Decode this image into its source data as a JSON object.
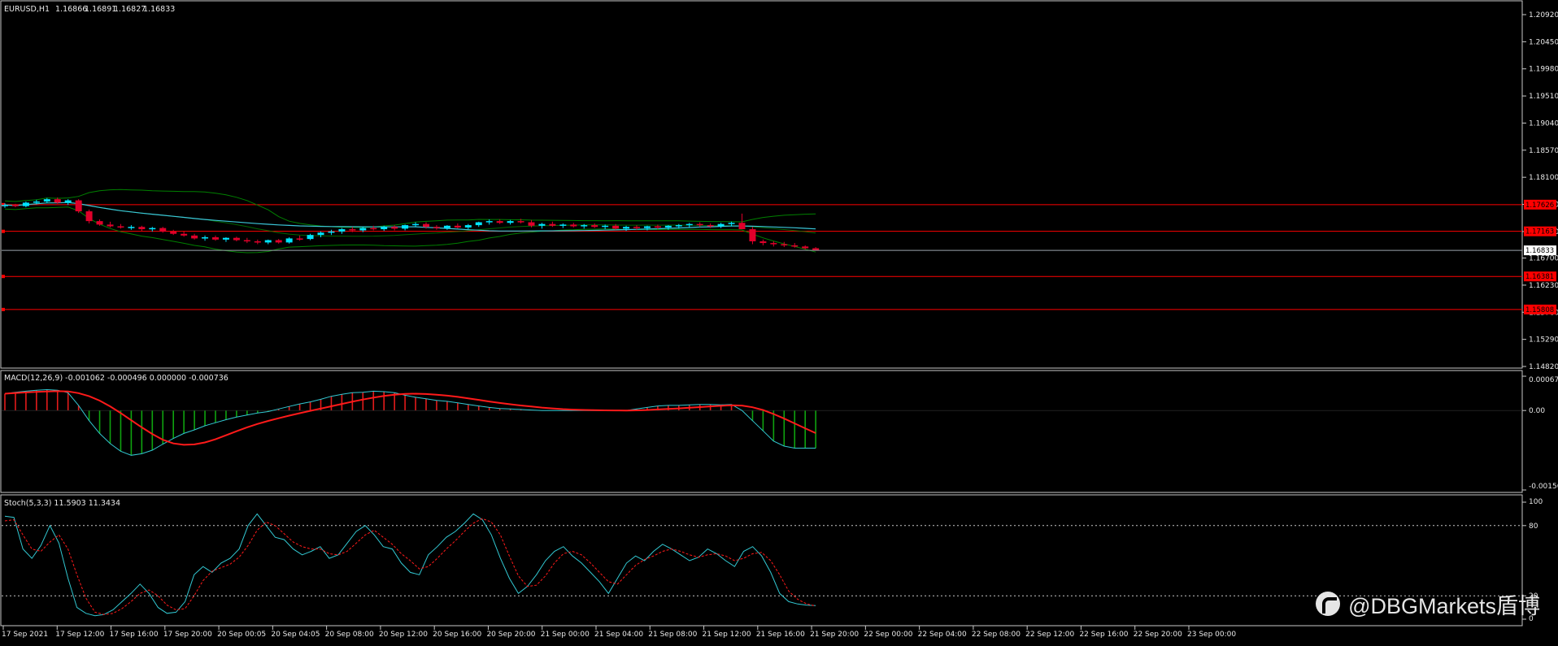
{
  "price_header": {
    "symbol": "EURUSD,H1",
    "open": "1.16866",
    "high": "1.16891",
    "low": "1.16827",
    "close": "1.16833"
  },
  "price_axis": {
    "ticks": [
      "1.20920",
      "1.20450",
      "1.19980",
      "1.19510",
      "1.19040",
      "1.18570",
      "1.18100",
      "1.17630",
      "1.17160",
      "1.16700",
      "1.16230",
      "1.15760",
      "1.15290",
      "1.14820"
    ],
    "current_price_label": "1.16833",
    "hline_labels": [
      "1.17626",
      "1.17163",
      "1.16381",
      "1.15808"
    ]
  },
  "macd": {
    "header": "MACD(12,26,9) -0.001062 -0.000496 0.000000 -0.000736",
    "ticks": [
      "0.000674",
      "0.00",
      "-0.001562"
    ]
  },
  "stoch": {
    "header": "Stoch(5,3,3) 11.5903 11.3434",
    "ticks": [
      "100",
      "80",
      "20",
      "0"
    ]
  },
  "time_axis": {
    "labels": [
      "17 Sep 2021",
      "17 Sep 12:00",
      "17 Sep 16:00",
      "17 Sep 20:00",
      "20 Sep 00:05",
      "20 Sep 04:05",
      "20 Sep 08:00",
      "20 Sep 12:00",
      "20 Sep 16:00",
      "20 Sep 20:00",
      "21 Sep 00:00",
      "21 Sep 04:00",
      "21 Sep 08:00",
      "21 Sep 12:00",
      "21 Sep 16:00",
      "21 Sep 20:00",
      "22 Sep 00:00",
      "22 Sep 04:00",
      "22 Sep 08:00",
      "22 Sep 12:00",
      "22 Sep 16:00",
      "22 Sep 20:00",
      "23 Sep 00:00"
    ]
  },
  "watermark": {
    "text": "@DBGMarkets盾博"
  },
  "colors": {
    "background": "#000000",
    "bull_candle": "#00e5ff",
    "bear_candle": "#e0002a",
    "hline": "#ff0000",
    "bollinger": "#008000",
    "moving_average": "#3bc6d8",
    "macd_main": "#32c8d2",
    "macd_signal": "#ff1a1a",
    "stoch_main": "#32c8d2",
    "stoch_signal": "#ff1a1a"
  },
  "chart_data": [
    {
      "type": "candlestick",
      "title": "EURUSD,H1",
      "ylim": [
        1.1482,
        1.2092
      ],
      "horizontal_levels": [
        1.17626,
        1.17163,
        1.16381,
        1.15808
      ],
      "current_price": 1.16833,
      "bar_count": 91,
      "candles": [
        [
          1.176,
          1.1765,
          1.1757,
          1.1762
        ],
        [
          1.1762,
          1.1764,
          1.1758,
          1.176
        ],
        [
          1.176,
          1.1768,
          1.1758,
          1.1766
        ],
        [
          1.1766,
          1.1771,
          1.1763,
          1.1768
        ],
        [
          1.1768,
          1.1774,
          1.1765,
          1.1772
        ],
        [
          1.1772,
          1.1775,
          1.1764,
          1.1766
        ],
        [
          1.1766,
          1.1772,
          1.1762,
          1.177
        ],
        [
          1.177,
          1.1772,
          1.1748,
          1.1751
        ],
        [
          1.1751,
          1.1754,
          1.173,
          1.1734
        ],
        [
          1.1734,
          1.1737,
          1.1726,
          1.1728
        ],
        [
          1.1728,
          1.1733,
          1.1723,
          1.1725
        ],
        [
          1.1725,
          1.1729,
          1.1721,
          1.1723
        ],
        [
          1.1723,
          1.1727,
          1.1719,
          1.1724
        ],
        [
          1.1724,
          1.1726,
          1.1717,
          1.172
        ],
        [
          1.172,
          1.1724,
          1.1716,
          1.1722
        ],
        [
          1.1722,
          1.1724,
          1.1714,
          1.1716
        ],
        [
          1.1716,
          1.1719,
          1.171,
          1.1712
        ],
        [
          1.1712,
          1.1716,
          1.1707,
          1.1709
        ],
        [
          1.1709,
          1.1712,
          1.1702,
          1.1704
        ],
        [
          1.1704,
          1.1709,
          1.17,
          1.1706
        ],
        [
          1.1706,
          1.1709,
          1.17,
          1.1702
        ],
        [
          1.1702,
          1.1706,
          1.1698,
          1.1705
        ],
        [
          1.1705,
          1.1707,
          1.1699,
          1.1701
        ],
        [
          1.1701,
          1.1705,
          1.1696,
          1.1699
        ],
        [
          1.1699,
          1.1702,
          1.1694,
          1.1697
        ],
        [
          1.1697,
          1.1702,
          1.1694,
          1.1701
        ],
        [
          1.1701,
          1.1703,
          1.1695,
          1.1697
        ],
        [
          1.1697,
          1.1706,
          1.1695,
          1.1704
        ],
        [
          1.1704,
          1.1709,
          1.17,
          1.1703
        ],
        [
          1.1703,
          1.1712,
          1.1701,
          1.171
        ],
        [
          1.171,
          1.1716,
          1.1706,
          1.1714
        ],
        [
          1.1714,
          1.1719,
          1.171,
          1.1716
        ],
        [
          1.1716,
          1.1722,
          1.1712,
          1.172
        ],
        [
          1.172,
          1.1724,
          1.1715,
          1.1718
        ],
        [
          1.1718,
          1.1724,
          1.1715,
          1.1722
        ],
        [
          1.1722,
          1.1726,
          1.1718,
          1.172
        ],
        [
          1.172,
          1.1726,
          1.1717,
          1.1724
        ],
        [
          1.1724,
          1.1727,
          1.1718,
          1.1721
        ],
        [
          1.1721,
          1.1728,
          1.1718,
          1.1727
        ],
        [
          1.1727,
          1.1732,
          1.1724,
          1.1729
        ],
        [
          1.1729,
          1.1732,
          1.1721,
          1.1724
        ],
        [
          1.1724,
          1.1727,
          1.1719,
          1.1722
        ],
        [
          1.1722,
          1.1727,
          1.1719,
          1.1726
        ],
        [
          1.1726,
          1.173,
          1.1721,
          1.1723
        ],
        [
          1.1723,
          1.1729,
          1.172,
          1.1727
        ],
        [
          1.1727,
          1.1733,
          1.1724,
          1.1732
        ],
        [
          1.1732,
          1.1737,
          1.1728,
          1.1734
        ],
        [
          1.1734,
          1.1737,
          1.1729,
          1.1731
        ],
        [
          1.1731,
          1.1736,
          1.1728,
          1.1734
        ],
        [
          1.1734,
          1.1738,
          1.173,
          1.1732
        ],
        [
          1.1732,
          1.1736,
          1.1723,
          1.1726
        ],
        [
          1.1726,
          1.1731,
          1.1721,
          1.1729
        ],
        [
          1.1729,
          1.1733,
          1.1724,
          1.1726
        ],
        [
          1.1726,
          1.173,
          1.1722,
          1.1728
        ],
        [
          1.1728,
          1.1731,
          1.1723,
          1.1725
        ],
        [
          1.1725,
          1.1729,
          1.1721,
          1.1727
        ],
        [
          1.1727,
          1.173,
          1.1722,
          1.1724
        ],
        [
          1.1724,
          1.1728,
          1.172,
          1.1726
        ],
        [
          1.1726,
          1.1729,
          1.1719,
          1.1721
        ],
        [
          1.1721,
          1.1726,
          1.1717,
          1.1724
        ],
        [
          1.1724,
          1.1727,
          1.1719,
          1.1722
        ],
        [
          1.1722,
          1.1726,
          1.1718,
          1.1725
        ],
        [
          1.1725,
          1.1728,
          1.172,
          1.1723
        ],
        [
          1.1723,
          1.1727,
          1.1719,
          1.1726
        ],
        [
          1.1726,
          1.1729,
          1.1721,
          1.1727
        ],
        [
          1.1727,
          1.1731,
          1.1723,
          1.1729
        ],
        [
          1.1729,
          1.1732,
          1.1724,
          1.1727
        ],
        [
          1.1727,
          1.173,
          1.1722,
          1.1725
        ],
        [
          1.1725,
          1.1731,
          1.1722,
          1.1729
        ],
        [
          1.1729,
          1.1733,
          1.1725,
          1.1731
        ],
        [
          1.1731,
          1.1747,
          1.1726,
          1.172
        ],
        [
          1.172,
          1.1724,
          1.1694,
          1.1699
        ],
        [
          1.1699,
          1.1702,
          1.1692,
          1.1696
        ],
        [
          1.1696,
          1.1699,
          1.169,
          1.1694
        ],
        [
          1.1694,
          1.1698,
          1.1689,
          1.1692
        ],
        [
          1.1692,
          1.1696,
          1.1688,
          1.169
        ],
        [
          1.169,
          1.1692,
          1.1685,
          1.1687
        ],
        [
          1.1687,
          1.1689,
          1.1683,
          1.1683
        ]
      ]
    },
    {
      "type": "bar+line",
      "title": "MACD(12,26,9)",
      "ylim": [
        -0.001562,
        0.000674
      ],
      "series": [
        {
          "name": "MACD",
          "values": [
            0.00033,
            0.00036,
            0.00038,
            0.0004,
            0.00041,
            0.0004,
            0.00035,
            0.0001,
            -0.0002,
            -0.00045,
            -0.00065,
            -0.0008,
            -0.00088,
            -0.00085,
            -0.00078,
            -0.00066,
            -0.00055,
            -0.00045,
            -0.00038,
            -0.0003,
            -0.00024,
            -0.00018,
            -0.00013,
            -9e-05,
            -5e-05,
            -2e-05,
            3e-05,
            8e-05,
            0.00013,
            0.00017,
            0.00022,
            0.00028,
            0.00032,
            0.00035,
            0.00036,
            0.00038,
            0.00037,
            0.00035,
            0.0003,
            0.00026,
            0.00023,
            0.0002,
            0.00018,
            0.00015,
            0.00012,
            9e-05,
            6e-05,
            4e-05,
            3e-05,
            2e-05,
            1e-05,
            0.0,
            0.0,
            0.0,
            0.0,
            0.0,
            0.0,
            0.0,
            0.0,
            0.0,
            3e-05,
            6e-05,
            9e-05,
            0.0001,
            0.0001,
            0.00011,
            0.00012,
            0.00012,
            0.00011,
            0.00012,
            0.0,
            -0.0002,
            -0.0004,
            -0.0006,
            -0.0007,
            -0.00074,
            -0.00074,
            -0.00074
          ]
        }
      ]
    },
    {
      "type": "line",
      "title": "Stoch(5,3,3)",
      "ylim": [
        0,
        100
      ],
      "levels": [
        80,
        20
      ],
      "series": [
        {
          "name": "main",
          "values": [
            88,
            87,
            60,
            52,
            63,
            80,
            65,
            35,
            10,
            5,
            3,
            4,
            8,
            15,
            22,
            30,
            22,
            10,
            5,
            6,
            15,
            38,
            45,
            40,
            48,
            52,
            60,
            80,
            90,
            80,
            70,
            68,
            60,
            55,
            58,
            62,
            52,
            55,
            65,
            75,
            80,
            72,
            62,
            60,
            48,
            40,
            38,
            55,
            62,
            70,
            75,
            82,
            90,
            85,
            72,
            52,
            35,
            22,
            28,
            38,
            50,
            58,
            62,
            54,
            48,
            40,
            32,
            22,
            35,
            48,
            54,
            50,
            58,
            64,
            60,
            55,
            50,
            53,
            60,
            56,
            50,
            45,
            58,
            62,
            54,
            40,
            22,
            15,
            13,
            12,
            11.59
          ]
        },
        {
          "name": "signal",
          "values": [
            84,
            85,
            72,
            60,
            58,
            66,
            72,
            60,
            38,
            18,
            6,
            4,
            5,
            9,
            15,
            22,
            25,
            20,
            12,
            8,
            9,
            20,
            33,
            41,
            44,
            47,
            53,
            63,
            76,
            83,
            80,
            73,
            66,
            62,
            60,
            60,
            56,
            55,
            58,
            65,
            72,
            76,
            70,
            64,
            56,
            50,
            43,
            45,
            52,
            60,
            67,
            75,
            82,
            86,
            83,
            72,
            54,
            37,
            28,
            29,
            37,
            48,
            56,
            58,
            55,
            48,
            40,
            32,
            30,
            38,
            46,
            51,
            54,
            58,
            60,
            58,
            55,
            53,
            55,
            56,
            54,
            50,
            52,
            56,
            57,
            50,
            38,
            24,
            17,
            13,
            11.34
          ]
        }
      ]
    }
  ]
}
